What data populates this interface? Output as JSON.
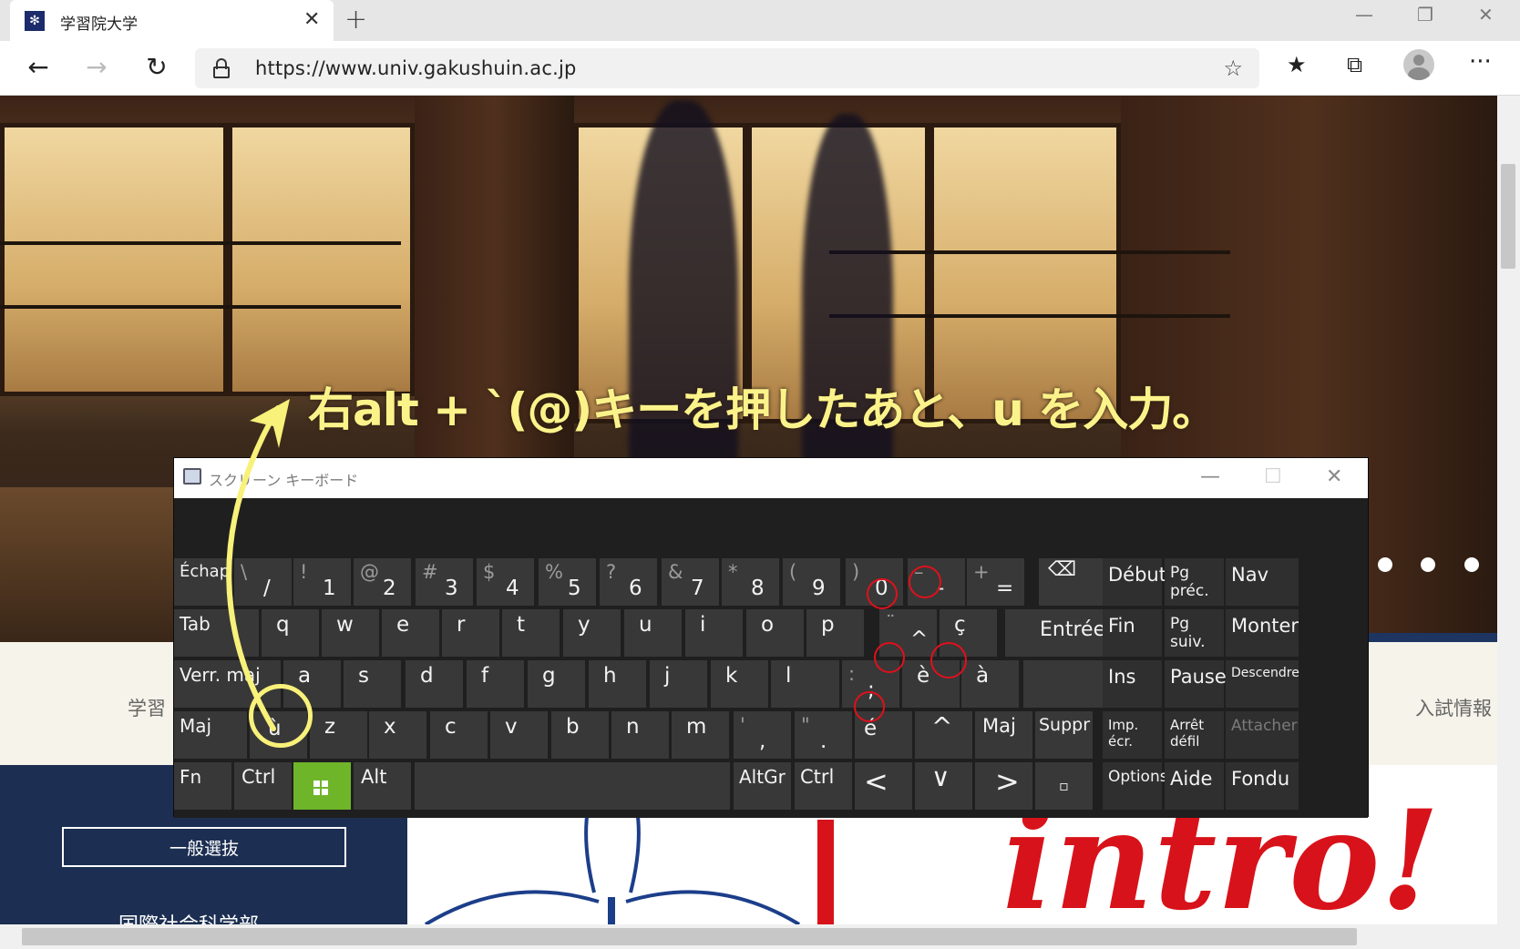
{
  "browser": {
    "tab_title": "学習院大学",
    "tab_close": "✕",
    "new_tab": "+",
    "url": "https://www.univ.gakushuin.ac.jp",
    "window_controls": {
      "minimize": "—",
      "restore": "❐",
      "close": "✕"
    },
    "nav": {
      "back": "←",
      "forward": "→",
      "refresh": "↻",
      "more": "···"
    },
    "toolbar_icons": {
      "favorites_star": "☆",
      "favorites_list": "★",
      "collections": "⧉"
    }
  },
  "page": {
    "strip_left": "学習",
    "strip_right": "入試情報",
    "general_button": "一般選抜",
    "faculty": "国際社会科学部",
    "intro_logo": "intro!"
  },
  "annotation": {
    "text": "右alt + `(@)キーを押したあと、u を入力。",
    "color": "#fbf38a"
  },
  "keyboard": {
    "title": "スクリーン キーボード",
    "controls": {
      "minimize": "—",
      "maximize": "☐",
      "close": "✕"
    },
    "row1": [
      {
        "main": "Échap"
      },
      {
        "shift": "\\",
        "low": "/"
      },
      {
        "shift": "!",
        "low": "1"
      },
      {
        "shift": "@",
        "low": "2"
      },
      {
        "shift": "#",
        "low": "3"
      },
      {
        "shift": "$",
        "low": "4"
      },
      {
        "shift": "%",
        "low": "5"
      },
      {
        "shift": "?",
        "low": "6"
      },
      {
        "shift": "&",
        "low": "7"
      },
      {
        "shift": "*",
        "low": "8"
      },
      {
        "shift": "(",
        "low": "9"
      },
      {
        "shift": ")",
        "low": "0"
      },
      {
        "shift": "–",
        "low": "-"
      },
      {
        "shift": "+",
        "low": "="
      },
      {
        "main": "⌫"
      }
    ],
    "row2": [
      "Tab",
      "q",
      "w",
      "e",
      "r",
      "t",
      "y",
      "u",
      "i",
      "o",
      "p",
      "^",
      "ç",
      "Entrée"
    ],
    "row2_circumflex_shift": "¨",
    "row3": [
      "Verr. maj",
      "a",
      "s",
      "d",
      "f",
      "g",
      "h",
      "j",
      "k",
      "l",
      "è",
      "à"
    ],
    "row3_semicolon": {
      "shift": ":",
      "low": ";"
    },
    "row4": [
      "Maj",
      "ù",
      "z",
      "x",
      "c",
      "v",
      "b",
      "n",
      "m",
      "é",
      "^",
      "Maj",
      "Suppr"
    ],
    "row4_comma": {
      "shift": "'",
      "low": ","
    },
    "row4_period": {
      "shift": "\"",
      "low": "."
    },
    "row5": [
      "Fn",
      "Ctrl",
      "Alt",
      "AltGr",
      "Ctrl",
      "<",
      "∨",
      ">",
      "▫"
    ],
    "nav_keys": [
      "Début",
      "Pg préc.",
      "Nav",
      "Fin",
      "Pg suiv.",
      "Monter",
      "Ins",
      "Pause",
      "Descendre",
      "Imp. écr.",
      "Arrêt défil",
      "Attacher",
      "Options",
      "Aide",
      "Fondu"
    ],
    "colors": {
      "key": "#383838",
      "windows_key": "#6fb52a",
      "highlight_red": "#e0101c",
      "highlight_yellow": "#f8f17a"
    }
  }
}
